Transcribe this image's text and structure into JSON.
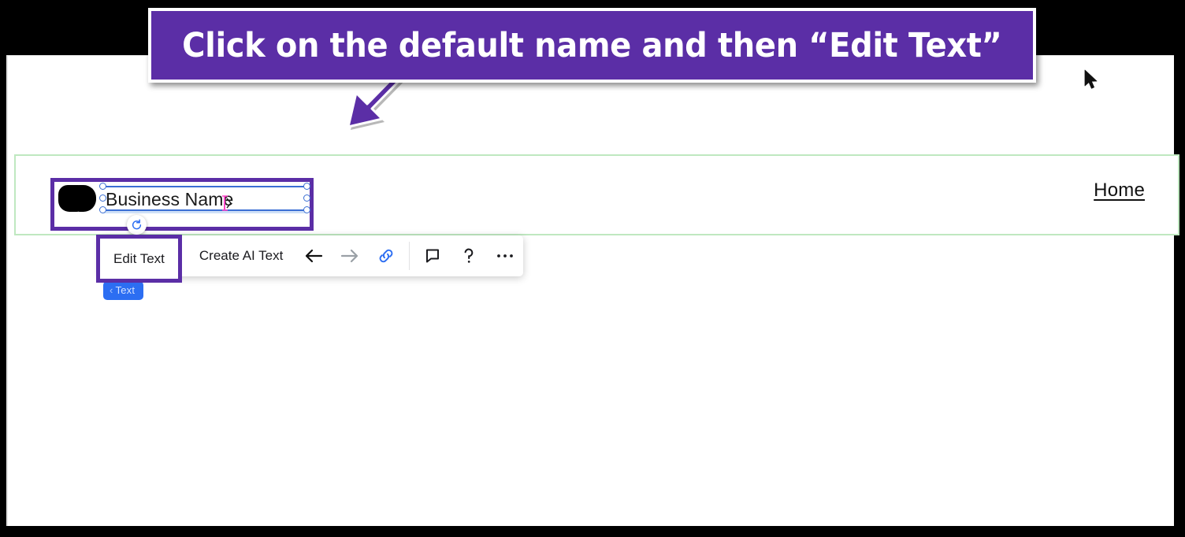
{
  "banner": {
    "text": "Click on the default name and then “Edit Text”",
    "background_color": "#5b2ea6",
    "text_color": "#ffffff",
    "arrow_icon": "arrow-down-left-icon"
  },
  "site": {
    "nav": {
      "home_label": "Home"
    },
    "header_section": {
      "logo_icon": "logo-mark-icon",
      "business_name_value": "Business Name"
    }
  },
  "toolbar": {
    "edit_text_label": "Edit Text",
    "create_ai_text_label": "Create AI Text",
    "highlight_color": "#5b2ea6",
    "icons": [
      {
        "name": "arrow-back-icon",
        "state": "enabled",
        "color": "#111111"
      },
      {
        "name": "arrow-forward-icon",
        "state": "disabled",
        "color": "#9aa0a6"
      },
      {
        "name": "link-icon",
        "state": "active",
        "color": "#2c6ef2"
      },
      {
        "name": "comment-icon",
        "state": "enabled",
        "color": "#1b1b1f"
      },
      {
        "name": "help-icon",
        "state": "enabled",
        "color": "#1b1b1f"
      },
      {
        "name": "more-options-icon",
        "state": "enabled",
        "color": "#1b1b1f"
      }
    ]
  },
  "breadcrumb_pill": {
    "chevron": "‹",
    "label": "Text",
    "background_color": "#2c6ef2"
  },
  "selection": {
    "handle_color": "#3b6fd4",
    "rotate_icon": "rotate-counterclockwise-icon",
    "caret_icon": "text-caret-icon",
    "caret_color": "#ff46c8"
  },
  "cursor": {
    "icon": "mouse-pointer-icon"
  }
}
